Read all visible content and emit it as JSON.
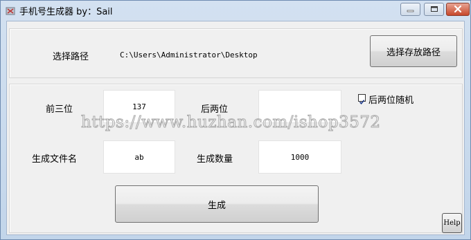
{
  "window": {
    "title": "手机号生成器 by：Sail",
    "minimize_icon": "minimize-icon",
    "maximize_icon": "maximize-icon",
    "close_icon": "close-icon"
  },
  "path_section": {
    "label": "选择路径",
    "path_value": "C:\\Users\\Administrator\\Desktop",
    "choose_button_label": "选择存放路径"
  },
  "form": {
    "prefix_label": "前三位",
    "prefix_value": "137",
    "suffix_label": "后两位",
    "suffix_value": "",
    "random_suffix_label": "后两位随机",
    "random_suffix_checked": true,
    "filename_label": "生成文件名",
    "filename_value": "ab",
    "count_label": "生成数量",
    "count_value": "1000",
    "generate_button_label": "生成",
    "help_button_label": "Help"
  },
  "watermark": "https://www.huzhan.com/ishop3572",
  "colors": {
    "titlebar": "#d3e1f1",
    "client_bg": "#f0f0f0",
    "close_button": "#c7482b"
  }
}
